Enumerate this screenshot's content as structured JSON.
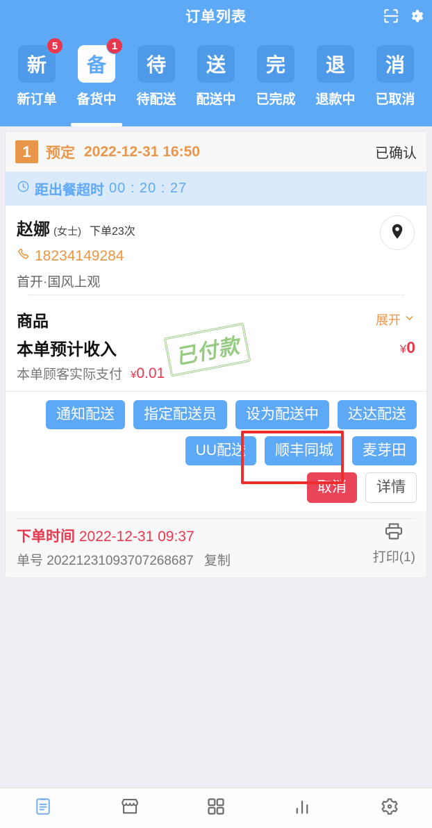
{
  "header": {
    "title": "订单列表",
    "icons": [
      {
        "name": "scan-icon",
        "label": "扫描"
      },
      {
        "name": "gear-icon",
        "label": "设置"
      }
    ]
  },
  "tabs": [
    {
      "glyph": "新",
      "label": "新订单",
      "badge": "5",
      "active": false
    },
    {
      "glyph": "备",
      "label": "备货中",
      "badge": "1",
      "active": true
    },
    {
      "glyph": "待",
      "label": "待配送",
      "badge": "",
      "active": false
    },
    {
      "glyph": "送",
      "label": "配送中",
      "badge": "",
      "active": false
    },
    {
      "glyph": "完",
      "label": "已完成",
      "badge": "",
      "active": false
    },
    {
      "glyph": "退",
      "label": "退款中",
      "badge": "",
      "active": false
    },
    {
      "glyph": "消",
      "label": "已取消",
      "badge": "",
      "active": false
    }
  ],
  "order": {
    "sequence": "1",
    "type": "预定",
    "scheduled_time": "2022-12-31 16:50",
    "status": "已确认",
    "countdown_label": "距出餐超时",
    "countdown_time": "00 : 20 : 27",
    "customer": {
      "name": "赵娜",
      "sex": "(女士)",
      "order_count": "下单23次",
      "phone": "18234149284",
      "address": "首开·国风上观"
    },
    "goods": {
      "title": "商品",
      "expand_label": "展开"
    },
    "income": {
      "label": "本单预计收入",
      "yen": "¥",
      "amount": "0",
      "paid_label": "本单顾客实际支付",
      "paid_yen": "¥",
      "paid_amount": "0.01",
      "stamp": "已付款"
    },
    "actions_row1": [
      "通知配送",
      "指定配送员",
      "设为配送中"
    ],
    "actions_row2": [
      "达达配送",
      "UU配送",
      "顺丰同城",
      "麦芽田"
    ],
    "cancel_label": "取消",
    "detail_label": "详情",
    "footer": {
      "time_label": "下单时间",
      "time_value": "2022-12-31 09:37",
      "no_label": "单号",
      "no_value": "20221231093707268687",
      "copy_label": "复制",
      "print_label": "打印(1)"
    }
  },
  "bottom_nav": [
    {
      "name": "orders-icon",
      "label": "订单",
      "active": true
    },
    {
      "name": "store-icon",
      "label": "店铺",
      "active": false
    },
    {
      "name": "grid-icon",
      "label": "应用",
      "active": false
    },
    {
      "name": "stats-icon",
      "label": "统计",
      "active": false
    },
    {
      "name": "settings-icon",
      "label": "设置",
      "active": false
    }
  ],
  "colors": {
    "brand_blue": "#5ea9f5",
    "accent_orange": "#e8974a",
    "danger_red": "#e8384f",
    "stamp_green": "#92c97d",
    "highlight_red": "#ef2d2d",
    "page_bg": "#efeef4"
  }
}
